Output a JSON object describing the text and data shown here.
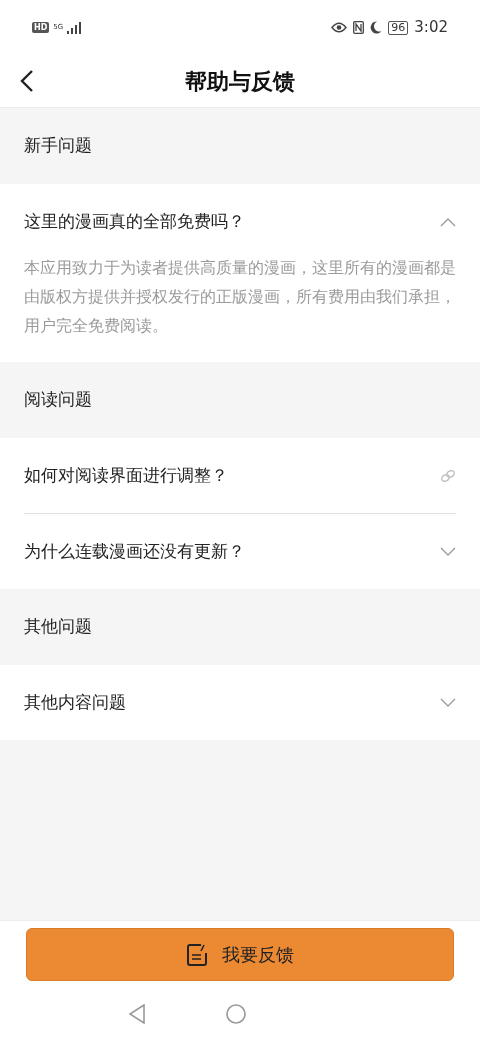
{
  "status_bar": {
    "hd": "HD",
    "network": "5G",
    "battery": "96",
    "time": "3:02"
  },
  "header": {
    "title": "帮助与反馈"
  },
  "sections": [
    {
      "title": "新手问题",
      "items": [
        {
          "kind": "accordion",
          "question": "这里的漫画真的全部免费吗？",
          "expanded": true,
          "answer": "本应用致力于为读者提供高质量的漫画，这里所有的漫画都是由版权方提供并授权发行的正版漫画，所有费用由我们承担，用户完全免费阅读。"
        }
      ]
    },
    {
      "title": "阅读问题",
      "items": [
        {
          "kind": "link",
          "question": "如何对阅读界面进行调整？"
        },
        {
          "kind": "accordion",
          "question": "为什么连载漫画还没有更新？",
          "expanded": false
        }
      ]
    },
    {
      "title": "其他问题",
      "items": [
        {
          "kind": "accordion",
          "question": "其他内容问题",
          "expanded": false
        }
      ]
    }
  ],
  "feedback_button": {
    "label": "我要反馈"
  }
}
